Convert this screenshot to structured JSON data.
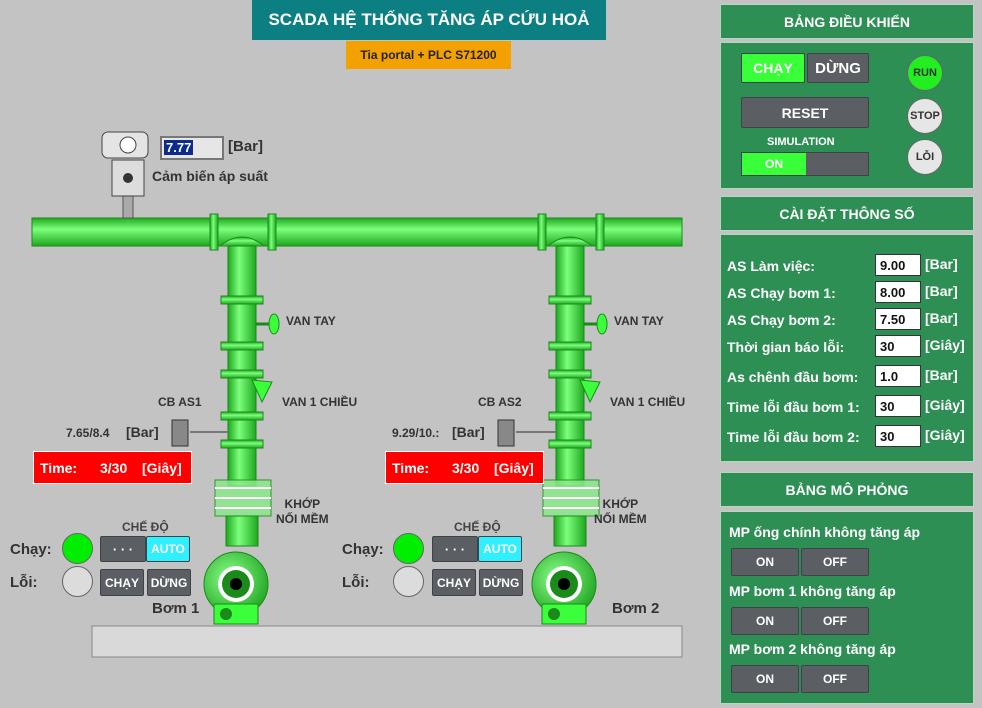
{
  "header": {
    "title": "SCADA HỆ THỐNG TĂNG ÁP CỨU HOẢ",
    "subtitle": "Tia portal + PLC S71200"
  },
  "sensor": {
    "value": "7.77",
    "unit": "[Bar]",
    "label": "Cảm biến áp suất"
  },
  "valves": {
    "manual": "VAN TAY",
    "check": "VAN 1 CHIỀU",
    "flex_line1": "KHỚP",
    "flex_line2": "NỐI MỀM"
  },
  "pump1": {
    "cb_label": "CB AS1",
    "pressure": "7.65/8.4",
    "unit": "[Bar]",
    "time_label": "Time:",
    "time_value": "3/30",
    "time_unit": "[Giây]",
    "name": "Bơm 1",
    "mode_label": "CHẾ ĐỘ",
    "mode_dots": "· · ·",
    "mode_auto": "AUTO",
    "run_label": "Chạy:",
    "fault_label": "Lỗi:",
    "run_btn": "CHẠY",
    "stop_btn": "DỪNG"
  },
  "pump2": {
    "cb_label": "CB AS2",
    "pressure": "9.29/10.:",
    "unit": "[Bar]",
    "time_label": "Time:",
    "time_value": "3/30",
    "time_unit": "[Giây]",
    "name": "Bơm 2",
    "mode_label": "CHẾ ĐỘ",
    "mode_dots": "· · ·",
    "mode_auto": "AUTO",
    "run_label": "Chạy:",
    "fault_label": "Lỗi:",
    "run_btn": "CHẠY",
    "stop_btn": "DỪNG"
  },
  "control": {
    "title": "BẢNG ĐIỀU KHIỂN",
    "run_btn": "CHẠY",
    "stop_btn": "DỪNG",
    "reset_btn": "RESET",
    "sim_label": "SIMULATION",
    "sim_on": "ON",
    "ind_run": "RUN",
    "ind_stop": "STOP",
    "ind_fault": "LỖI"
  },
  "settings": {
    "title": "CÀI ĐẶT THÔNG SỐ",
    "rows": [
      {
        "label": "AS Làm việc:",
        "value": "9.00",
        "unit": "[Bar]"
      },
      {
        "label": "AS Chạy bơm 1:",
        "value": "8.00",
        "unit": "[Bar]"
      },
      {
        "label": "AS Chạy bơm 2:",
        "value": "7.50",
        "unit": "[Bar]"
      },
      {
        "label": "Thời gian báo lỗi:",
        "value": "30",
        "unit": "[Giây]"
      },
      {
        "label": "As chênh đầu bơm:",
        "value": "1.0",
        "unit": "[Bar]"
      },
      {
        "label": "Time lỗi đầu bơm 1:",
        "value": "30",
        "unit": "[Giây]"
      },
      {
        "label": "Time lỗi đầu bơm 2:",
        "value": "30",
        "unit": "[Giây]"
      }
    ]
  },
  "simulation": {
    "title": "BẢNG MÔ PHỎNG",
    "items": [
      {
        "label": "MP ống chính không tăng áp",
        "on": "ON",
        "off": "OFF"
      },
      {
        "label": "MP bơm 1 không tăng áp",
        "on": "ON",
        "off": "OFF"
      },
      {
        "label": "MP bơm 2 không tăng áp",
        "on": "ON",
        "off": "OFF"
      }
    ]
  },
  "colors": {
    "pipe": "#3cff3c",
    "panel": "#2e8f55",
    "title": "#0c7f82",
    "alarm": "#ff0000"
  }
}
